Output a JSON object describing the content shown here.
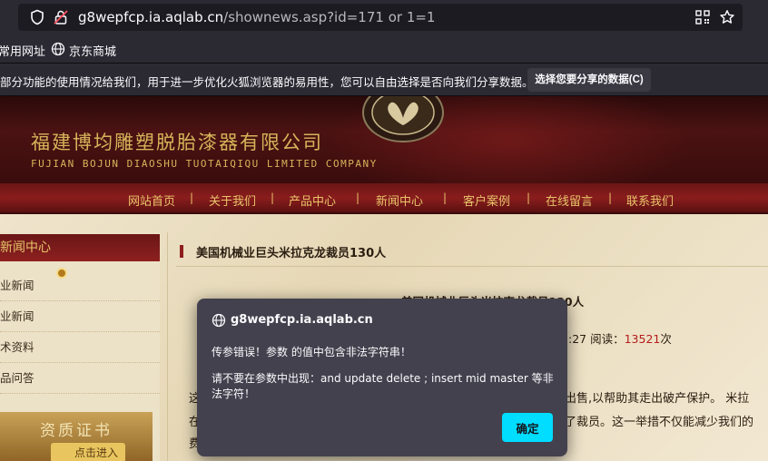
{
  "browser": {
    "url_host": "g8wepfcp.ia.aqlab.cn",
    "url_path": "/shownews.asp?id=171 or 1=1",
    "bookmarks": [
      "常用网址",
      "京东商城"
    ],
    "notification": {
      "text": "部分功能的使用情况给我们，用于进一步优化火狐浏览器的易用性，您可以自由选择是否向我们分享数据。",
      "button": "选择您要分享的数据(C)"
    }
  },
  "site": {
    "company_cn": "福建博均雕塑脱胎漆器有限公司",
    "company_en": "FUJIAN BOJUN DIAOSHU  TUOTAIQIQU  LIMITED COMPANY",
    "nav": [
      "网站首页",
      "关于我们",
      "产品中心",
      "新闻中心",
      "客户案例",
      "在线留言",
      "联系我们"
    ],
    "nav_separator": "|",
    "sidebar": {
      "title": "新闻中心",
      "items": [
        "业新闻",
        "业新闻",
        "术资料",
        "品问答"
      ],
      "badge_title": "资质证书",
      "badge_button": "点击进入"
    },
    "article": {
      "header_title": "美国机械业巨头米拉克龙裁员130人",
      "title": "美国机械业巨头米拉克龙裁员130人",
      "meta_prefix": ":27 阅读：",
      "views": "13521",
      "meta_suffix": "次",
      "body_line1_left": "这",
      "body_line1_right": "出售,以帮助其走出破产保护。 米拉",
      "body_line2_left": "在",
      "body_line2_right": "了裁员。这一举措不仅能减少我们的",
      "body_line3_left": "费"
    }
  },
  "dialog": {
    "origin": "g8wepfcp.ia.aqlab.cn",
    "message1": "传参错误！参数 的值中包含非法字符串！",
    "message2": "请不要在参数中出现：and update delete ; insert mid master 等非法字符！",
    "ok_button": "确定"
  },
  "colors": {
    "accent": "#00ddff",
    "dialog_bg": "#42414d",
    "nav_gold": "#e8c46a",
    "site_red": "#8e2020"
  }
}
